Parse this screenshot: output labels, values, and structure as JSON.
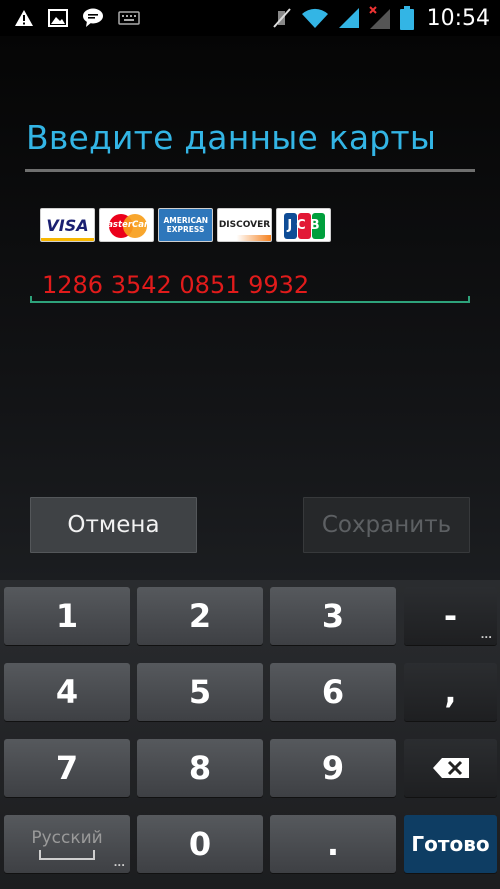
{
  "status_bar": {
    "time": "10:54",
    "left_icons": [
      "warning-icon",
      "image-icon",
      "chat-icon",
      "keyboard-icon"
    ],
    "right_icons": [
      "mute-icon",
      "wifi-icon",
      "signal-icon",
      "signal-no-service-icon",
      "battery-icon"
    ]
  },
  "dialog": {
    "title": "Введите данные карты",
    "cards": [
      "VISA",
      "MasterCard",
      "AMERICAN EXPRESS",
      "DISCOVER",
      "JCB"
    ],
    "card_number": "1286 3542 0851 9932",
    "cancel_label": "Отмена",
    "save_label": "Сохранить"
  },
  "keyboard": {
    "rows": [
      [
        "1",
        "2",
        "3",
        "-"
      ],
      [
        "4",
        "5",
        "6",
        ","
      ],
      [
        "7",
        "8",
        "9",
        ""
      ],
      [
        "Русский",
        "0",
        ".",
        "Готово"
      ]
    ]
  },
  "colors": {
    "title": "#33b5e5",
    "input_text": "#e11b1b",
    "input_underline": "#2ea37b",
    "done_key": "#0e3d63"
  }
}
